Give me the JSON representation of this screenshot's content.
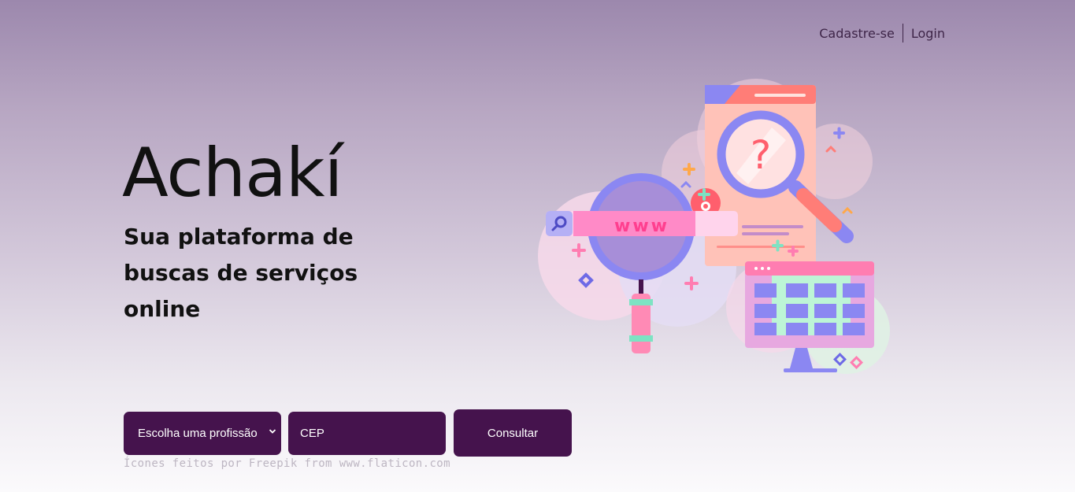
{
  "nav": {
    "signup": "Cadastre-se",
    "login": "Login"
  },
  "hero": {
    "title": "Achakí",
    "subtitle": "Sua plataforma de buscas de serviços online"
  },
  "search": {
    "profession_select": "Escolha uma profissão",
    "cep_placeholder": "CEP",
    "submit": "Consultar"
  },
  "illustration": {
    "url_text": "www",
    "question_mark": "?"
  },
  "credits": "Ícones feitos por Freepik from www.flaticon.com",
  "colors": {
    "accent": "#45134d",
    "background_top": "#9c88ad",
    "background_bottom": "#fbfafc"
  }
}
